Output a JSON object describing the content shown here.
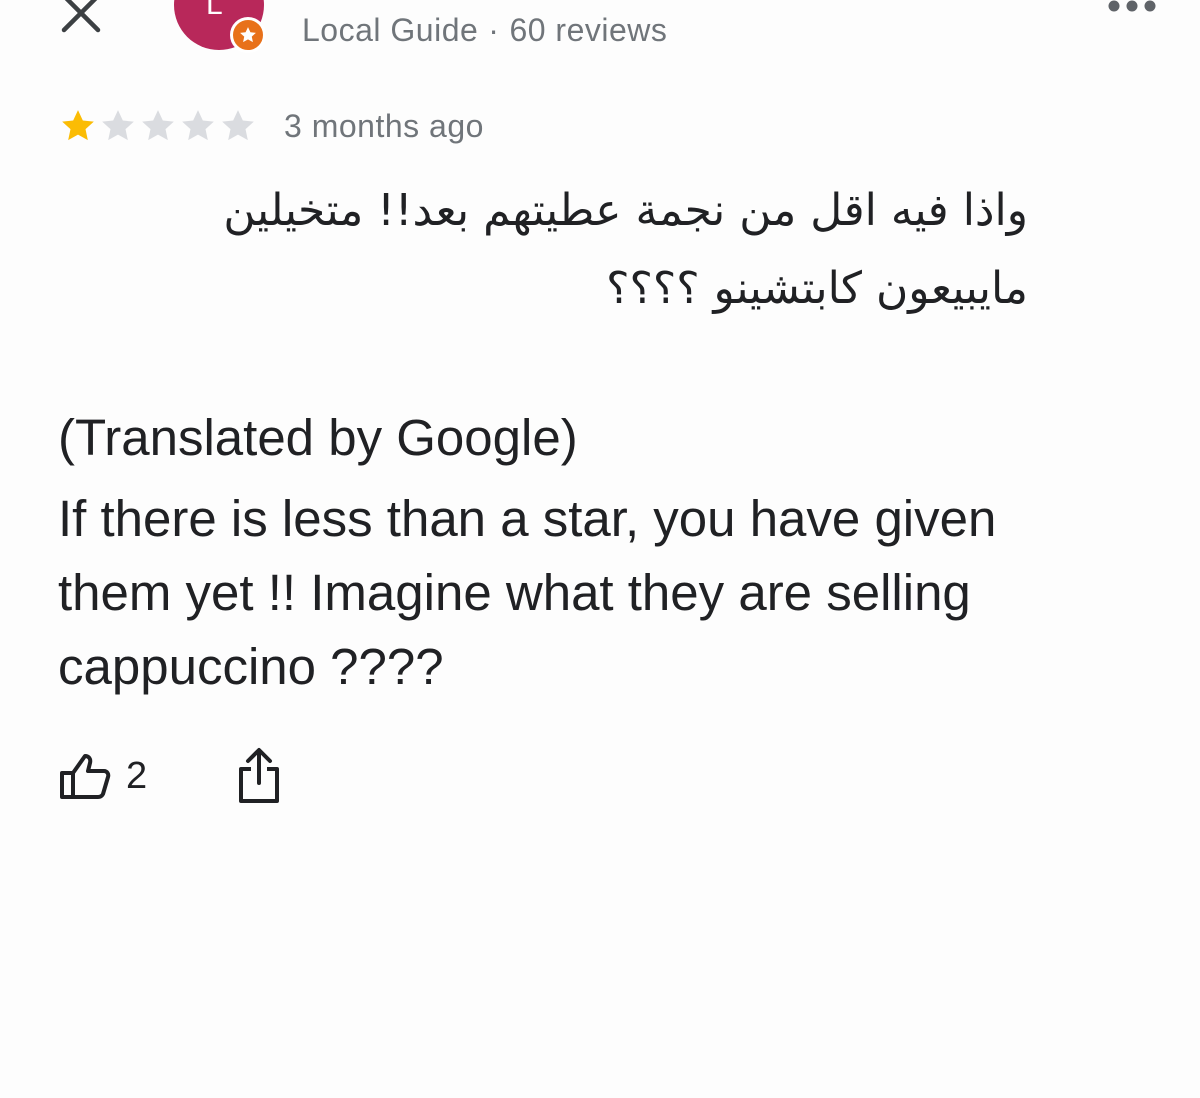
{
  "header": {
    "close_icon": "close-icon",
    "more_icon": "more-horiz-icon",
    "avatar_letter": "L",
    "avatar_color": "#b8285a",
    "badge_color": "#e8711a",
    "badge_icon": "star-icon",
    "reviewer_role": "Local Guide",
    "separator": "·",
    "review_count": "60 reviews"
  },
  "review": {
    "rating": 1,
    "max_rating": 5,
    "star_filled_color": "#fbbc04",
    "star_empty_color": "#dadce0",
    "time": "3 months ago",
    "original_text": "واذا فيه اقل من نجمة عطيتهم بعد!! متخيلين مايبيعون كابتشينو ؟؟؟؟",
    "translated_label": "(Translated by Google)",
    "translated_text": "If there is less than a star, you have given them yet !! Imagine what they are selling cappuccino ????"
  },
  "actions": {
    "like_icon": "thumb-up-icon",
    "like_count": "2",
    "share_icon": "share-icon"
  }
}
